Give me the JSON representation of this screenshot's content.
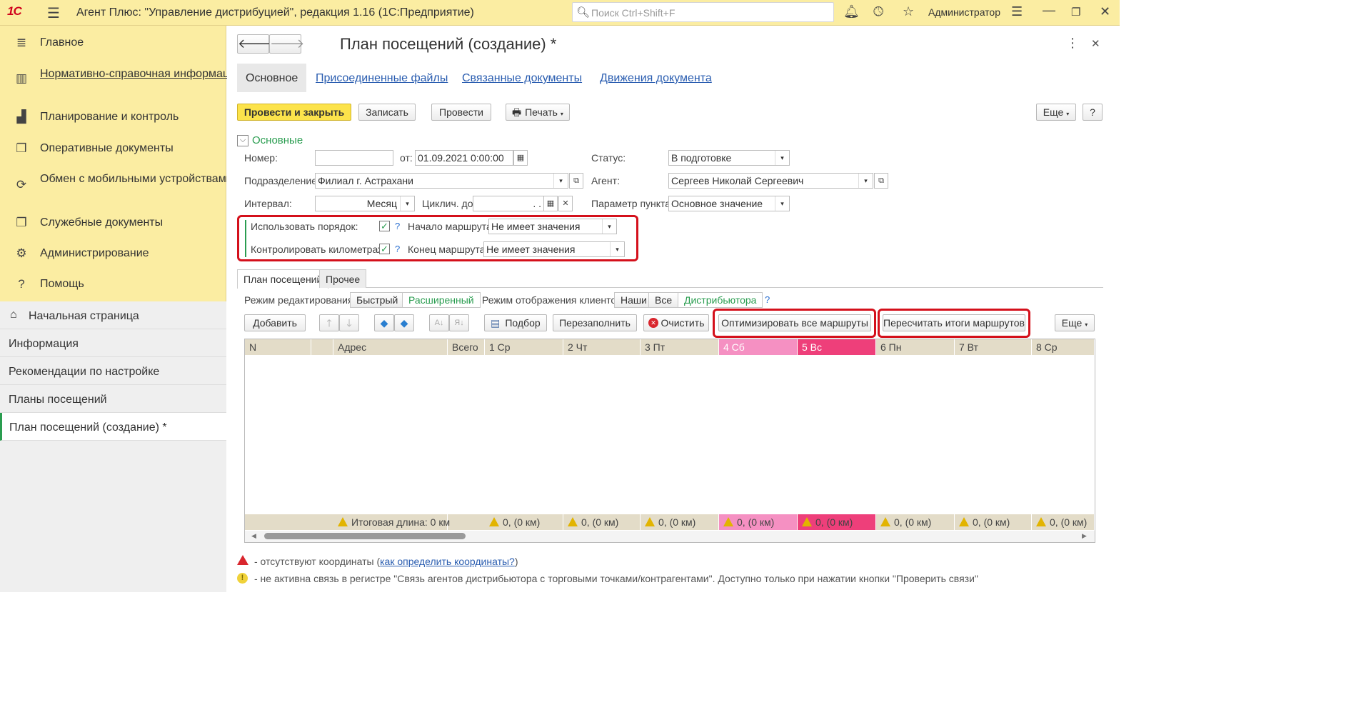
{
  "titlebar": {
    "logo": "1С",
    "title": "Агент Плюс: \"Управление дистрибуцией\", редакция 1.16  (1С:Предприятие)",
    "search_placeholder": "Поиск Ctrl+Shift+F",
    "user": "Администратор"
  },
  "sidebar": {
    "items": [
      {
        "label": "Главное",
        "icon": "menu-lines-icon"
      },
      {
        "label": "Нормативно-справочная информация",
        "icon": "catalog-icon"
      },
      {
        "label": "Планирование и контроль",
        "icon": "chart-icon"
      },
      {
        "label": "Оперативные документы",
        "icon": "documents-icon"
      },
      {
        "label": "Обмен с мобильными устройствами",
        "icon": "sync-icon"
      },
      {
        "label": "Служебные документы",
        "icon": "service-docs-icon"
      },
      {
        "label": "Администрирование",
        "icon": "gear-icon"
      },
      {
        "label": "Помощь",
        "icon": "help-icon"
      }
    ],
    "open": [
      {
        "label": "Начальная страница"
      },
      {
        "label": "Информация"
      },
      {
        "label": "Рекомендации по настройке"
      },
      {
        "label": "Планы посещений"
      },
      {
        "label": "План посещений  (создание) *"
      }
    ]
  },
  "form": {
    "title": "План посещений  (создание) *",
    "nav_tabs": [
      "Основное",
      "Присоединенные файлы",
      "Связанные документы",
      "Движения документа"
    ],
    "toolbar": {
      "post_close": "Провести и закрыть",
      "save": "Записать",
      "post": "Провести",
      "print": "Печать",
      "more": "Еще",
      "help": "?"
    },
    "group_title": "Основные",
    "fields": {
      "number_label": "Номер:",
      "number_value": "",
      "date_label": "от:",
      "date_value": "01.09.2021  0:00:00",
      "status_label": "Статус:",
      "status_value": "В подготовке",
      "division_label": "Подразделение:",
      "division_value": "Филиал г. Астрахани",
      "agent_label": "Агент:",
      "agent_value": "Сергеев Николай Сергеевич",
      "interval_label": "Интервал:",
      "interval_value": "Месяц",
      "cycle_label": "Циклич. до:",
      "cycle_value": ".   .",
      "point_param_label": "Параметр пункта:",
      "point_param_value": "Основное значение",
      "use_order_label": "Использовать порядок:",
      "route_start_label": "Начало маршрута:",
      "route_start_value": "Не имеет значения",
      "control_km_label": "Контролировать километраж:",
      "route_end_label": "Конец маршрута:",
      "route_end_value": "Не имеет значения"
    },
    "inner_tabs": [
      "План посещений",
      "Прочее"
    ],
    "edit_mode_label": "Режим редактирования:",
    "edit_modes": [
      "Быстрый",
      "Расширенный"
    ],
    "display_mode_label": "Режим отображения клиентов:",
    "display_modes": [
      "Наши",
      "Все",
      "Дистрибьютора"
    ],
    "table_toolbar": {
      "add": "Добавить",
      "pick": "Подбор",
      "refill": "Перезаполнить",
      "clear": "Очистить",
      "optimize": "Оптимизировать все маршруты",
      "recalc": "Пересчитать итоги маршрутов",
      "more": "Еще"
    },
    "table": {
      "columns": [
        "N",
        "",
        "Адрес",
        "Всего",
        "1 Ср",
        "2 Чт",
        "3 Пт",
        "4 Сб",
        "5 Вс",
        "6 Пн",
        "7 Вт",
        "8 Ср"
      ],
      "footer_total": "Итоговая длина: 0 км",
      "footer_day": "0, (0 км)"
    },
    "legend": {
      "missing_coords": "- отсутствуют координаты (",
      "missing_coords_link": "как определить координаты?",
      "missing_coords_end": ")",
      "inactive_link": "- не активна связь в регистре \"Связь агентов дистрибьютора с торговыми точками/контрагентами\". Доступно только при нажатии кнопки \"Проверить связи\""
    },
    "colors": {
      "saturday": "#f590c2",
      "sunday": "#ee3f7a",
      "highlight_red": "#d4101b",
      "accent_green": "#2a9d50"
    }
  }
}
